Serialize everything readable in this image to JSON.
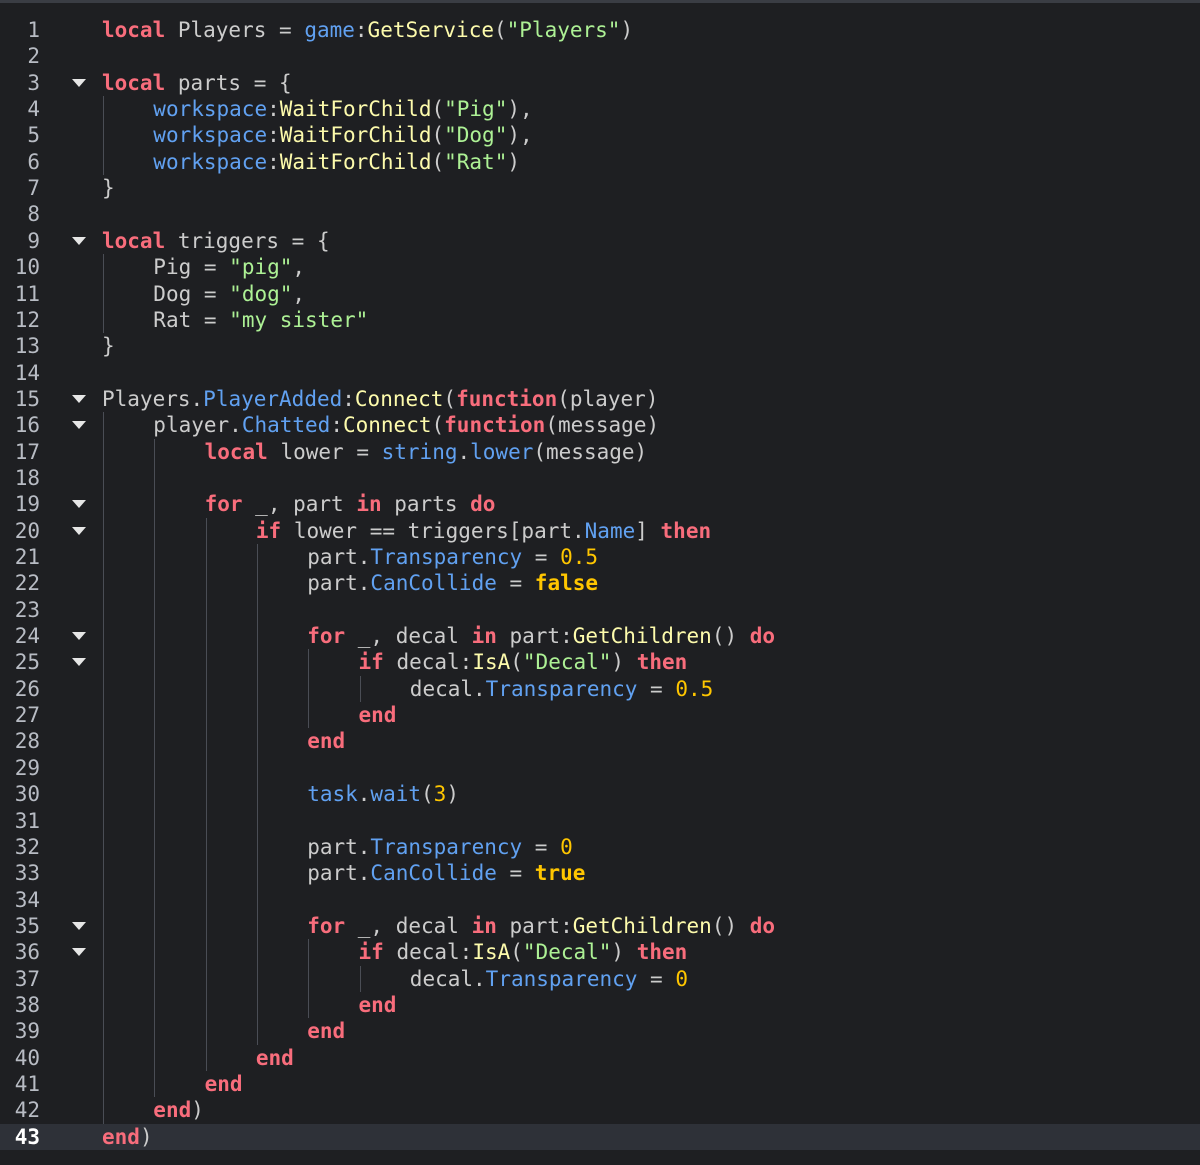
{
  "editor": {
    "language": "Luau",
    "current_line": 43,
    "theme": {
      "background": "#1e1f22",
      "keyword": "#f86d7c",
      "string": "#adf195",
      "number": "#ffc600",
      "function": "#fdfbac",
      "property": "#61a1f1",
      "text": "#cccccc",
      "current_line": "#2e3138"
    },
    "lines": [
      {
        "n": "1",
        "fold": false,
        "depth": 0,
        "tokens": [
          [
            "kw",
            "local"
          ],
          [
            "id",
            " Players "
          ],
          [
            "op",
            "= "
          ],
          [
            "prop",
            "game"
          ],
          [
            "op",
            ":"
          ],
          [
            "fn",
            "GetService"
          ],
          [
            "op",
            "("
          ],
          [
            "str",
            "\"Players\""
          ],
          [
            "op",
            ")"
          ]
        ]
      },
      {
        "n": "2",
        "fold": false,
        "depth": 0,
        "tokens": []
      },
      {
        "n": "3",
        "fold": true,
        "depth": 0,
        "tokens": [
          [
            "kw",
            "local"
          ],
          [
            "id",
            " parts "
          ],
          [
            "op",
            "= {"
          ]
        ]
      },
      {
        "n": "4",
        "fold": false,
        "depth": 1,
        "tokens": [
          [
            "prop",
            "workspace"
          ],
          [
            "op",
            ":"
          ],
          [
            "fn",
            "WaitForChild"
          ],
          [
            "op",
            "("
          ],
          [
            "str",
            "\"Pig\""
          ],
          [
            "op",
            "),"
          ]
        ]
      },
      {
        "n": "5",
        "fold": false,
        "depth": 1,
        "tokens": [
          [
            "prop",
            "workspace"
          ],
          [
            "op",
            ":"
          ],
          [
            "fn",
            "WaitForChild"
          ],
          [
            "op",
            "("
          ],
          [
            "str",
            "\"Dog\""
          ],
          [
            "op",
            "),"
          ]
        ]
      },
      {
        "n": "6",
        "fold": false,
        "depth": 1,
        "tokens": [
          [
            "prop",
            "workspace"
          ],
          [
            "op",
            ":"
          ],
          [
            "fn",
            "WaitForChild"
          ],
          [
            "op",
            "("
          ],
          [
            "str",
            "\"Rat\""
          ],
          [
            "op",
            ")"
          ]
        ]
      },
      {
        "n": "7",
        "fold": false,
        "depth": 0,
        "tokens": [
          [
            "op",
            "}"
          ]
        ]
      },
      {
        "n": "8",
        "fold": false,
        "depth": 0,
        "tokens": []
      },
      {
        "n": "9",
        "fold": true,
        "depth": 0,
        "tokens": [
          [
            "kw",
            "local"
          ],
          [
            "id",
            " triggers "
          ],
          [
            "op",
            "= {"
          ]
        ]
      },
      {
        "n": "10",
        "fold": false,
        "depth": 1,
        "tokens": [
          [
            "id",
            "Pig "
          ],
          [
            "op",
            "= "
          ],
          [
            "str",
            "\"pig\""
          ],
          [
            "op",
            ","
          ]
        ]
      },
      {
        "n": "11",
        "fold": false,
        "depth": 1,
        "tokens": [
          [
            "id",
            "Dog "
          ],
          [
            "op",
            "= "
          ],
          [
            "str",
            "\"dog\""
          ],
          [
            "op",
            ","
          ]
        ]
      },
      {
        "n": "12",
        "fold": false,
        "depth": 1,
        "tokens": [
          [
            "id",
            "Rat "
          ],
          [
            "op",
            "= "
          ],
          [
            "str",
            "\"my sister\""
          ]
        ]
      },
      {
        "n": "13",
        "fold": false,
        "depth": 0,
        "tokens": [
          [
            "op",
            "}"
          ]
        ]
      },
      {
        "n": "14",
        "fold": false,
        "depth": 0,
        "tokens": []
      },
      {
        "n": "15",
        "fold": true,
        "depth": 0,
        "tokens": [
          [
            "id",
            "Players"
          ],
          [
            "op",
            "."
          ],
          [
            "prop",
            "PlayerAdded"
          ],
          [
            "op",
            ":"
          ],
          [
            "fn",
            "Connect"
          ],
          [
            "op",
            "("
          ],
          [
            "kw",
            "function"
          ],
          [
            "op",
            "("
          ],
          [
            "id",
            "player"
          ],
          [
            "op",
            ")"
          ]
        ]
      },
      {
        "n": "16",
        "fold": true,
        "depth": 1,
        "tokens": [
          [
            "id",
            "player"
          ],
          [
            "op",
            "."
          ],
          [
            "prop",
            "Chatted"
          ],
          [
            "op",
            ":"
          ],
          [
            "fn",
            "Connect"
          ],
          [
            "op",
            "("
          ],
          [
            "kw",
            "function"
          ],
          [
            "op",
            "("
          ],
          [
            "id",
            "message"
          ],
          [
            "op",
            ")"
          ]
        ]
      },
      {
        "n": "17",
        "fold": false,
        "depth": 2,
        "tokens": [
          [
            "kw",
            "local"
          ],
          [
            "id",
            " lower "
          ],
          [
            "op",
            "= "
          ],
          [
            "prop",
            "string"
          ],
          [
            "op",
            "."
          ],
          [
            "prop",
            "lower"
          ],
          [
            "op",
            "("
          ],
          [
            "id",
            "message"
          ],
          [
            "op",
            ")"
          ]
        ]
      },
      {
        "n": "18",
        "fold": false,
        "depth": 2,
        "tokens": []
      },
      {
        "n": "19",
        "fold": true,
        "depth": 2,
        "tokens": [
          [
            "kw",
            "for"
          ],
          [
            "id",
            " _, part "
          ],
          [
            "kw",
            "in"
          ],
          [
            "id",
            " parts "
          ],
          [
            "kw",
            "do"
          ]
        ]
      },
      {
        "n": "20",
        "fold": true,
        "depth": 3,
        "tokens": [
          [
            "kw",
            "if"
          ],
          [
            "id",
            " lower "
          ],
          [
            "op",
            "== "
          ],
          [
            "id",
            "triggers[part."
          ],
          [
            "prop",
            "Name"
          ],
          [
            "id",
            "] "
          ],
          [
            "kw",
            "then"
          ]
        ]
      },
      {
        "n": "21",
        "fold": false,
        "depth": 4,
        "tokens": [
          [
            "id",
            "part"
          ],
          [
            "op",
            "."
          ],
          [
            "prop",
            "Transparency"
          ],
          [
            "op",
            " = "
          ],
          [
            "num",
            "0.5"
          ]
        ]
      },
      {
        "n": "22",
        "fold": false,
        "depth": 4,
        "tokens": [
          [
            "id",
            "part"
          ],
          [
            "op",
            "."
          ],
          [
            "prop",
            "CanCollide"
          ],
          [
            "op",
            " = "
          ],
          [
            "bool",
            "false"
          ]
        ]
      },
      {
        "n": "23",
        "fold": false,
        "depth": 4,
        "tokens": []
      },
      {
        "n": "24",
        "fold": true,
        "depth": 4,
        "tokens": [
          [
            "kw",
            "for"
          ],
          [
            "id",
            " _, decal "
          ],
          [
            "kw",
            "in"
          ],
          [
            "id",
            " part"
          ],
          [
            "op",
            ":"
          ],
          [
            "fn",
            "GetChildren"
          ],
          [
            "op",
            "() "
          ],
          [
            "kw",
            "do"
          ]
        ]
      },
      {
        "n": "25",
        "fold": true,
        "depth": 5,
        "tokens": [
          [
            "kw",
            "if"
          ],
          [
            "id",
            " decal"
          ],
          [
            "op",
            ":"
          ],
          [
            "fn",
            "IsA"
          ],
          [
            "op",
            "("
          ],
          [
            "str",
            "\"Decal\""
          ],
          [
            "op",
            ") "
          ],
          [
            "kw",
            "then"
          ]
        ]
      },
      {
        "n": "26",
        "fold": false,
        "depth": 6,
        "tokens": [
          [
            "id",
            "decal"
          ],
          [
            "op",
            "."
          ],
          [
            "prop",
            "Transparency"
          ],
          [
            "op",
            " = "
          ],
          [
            "num",
            "0.5"
          ]
        ]
      },
      {
        "n": "27",
        "fold": false,
        "depth": 5,
        "tokens": [
          [
            "kw",
            "end"
          ]
        ]
      },
      {
        "n": "28",
        "fold": false,
        "depth": 4,
        "tokens": [
          [
            "kw",
            "end"
          ]
        ]
      },
      {
        "n": "29",
        "fold": false,
        "depth": 4,
        "tokens": []
      },
      {
        "n": "30",
        "fold": false,
        "depth": 4,
        "tokens": [
          [
            "prop",
            "task"
          ],
          [
            "op",
            "."
          ],
          [
            "prop",
            "wait"
          ],
          [
            "op",
            "("
          ],
          [
            "num",
            "3"
          ],
          [
            "op",
            ")"
          ]
        ]
      },
      {
        "n": "31",
        "fold": false,
        "depth": 4,
        "tokens": []
      },
      {
        "n": "32",
        "fold": false,
        "depth": 4,
        "tokens": [
          [
            "id",
            "part"
          ],
          [
            "op",
            "."
          ],
          [
            "prop",
            "Transparency"
          ],
          [
            "op",
            " = "
          ],
          [
            "num",
            "0"
          ]
        ]
      },
      {
        "n": "33",
        "fold": false,
        "depth": 4,
        "tokens": [
          [
            "id",
            "part"
          ],
          [
            "op",
            "."
          ],
          [
            "prop",
            "CanCollide"
          ],
          [
            "op",
            " = "
          ],
          [
            "bool",
            "true"
          ]
        ]
      },
      {
        "n": "34",
        "fold": false,
        "depth": 4,
        "tokens": []
      },
      {
        "n": "35",
        "fold": true,
        "depth": 4,
        "tokens": [
          [
            "kw",
            "for"
          ],
          [
            "id",
            " _, decal "
          ],
          [
            "kw",
            "in"
          ],
          [
            "id",
            " part"
          ],
          [
            "op",
            ":"
          ],
          [
            "fn",
            "GetChildren"
          ],
          [
            "op",
            "() "
          ],
          [
            "kw",
            "do"
          ]
        ]
      },
      {
        "n": "36",
        "fold": true,
        "depth": 5,
        "tokens": [
          [
            "kw",
            "if"
          ],
          [
            "id",
            " decal"
          ],
          [
            "op",
            ":"
          ],
          [
            "fn",
            "IsA"
          ],
          [
            "op",
            "("
          ],
          [
            "str",
            "\"Decal\""
          ],
          [
            "op",
            ") "
          ],
          [
            "kw",
            "then"
          ]
        ]
      },
      {
        "n": "37",
        "fold": false,
        "depth": 6,
        "tokens": [
          [
            "id",
            "decal"
          ],
          [
            "op",
            "."
          ],
          [
            "prop",
            "Transparency"
          ],
          [
            "op",
            " = "
          ],
          [
            "num",
            "0"
          ]
        ]
      },
      {
        "n": "38",
        "fold": false,
        "depth": 5,
        "tokens": [
          [
            "kw",
            "end"
          ]
        ]
      },
      {
        "n": "39",
        "fold": false,
        "depth": 4,
        "tokens": [
          [
            "kw",
            "end"
          ]
        ]
      },
      {
        "n": "40",
        "fold": false,
        "depth": 3,
        "tokens": [
          [
            "kw",
            "end"
          ]
        ]
      },
      {
        "n": "41",
        "fold": false,
        "depth": 2,
        "tokens": [
          [
            "kw",
            "end"
          ]
        ]
      },
      {
        "n": "42",
        "fold": false,
        "depth": 1,
        "tokens": [
          [
            "kw",
            "end"
          ],
          [
            "op",
            ")"
          ]
        ]
      },
      {
        "n": "43",
        "fold": false,
        "depth": 0,
        "tokens": [
          [
            "kw",
            "end"
          ],
          [
            "op",
            ")"
          ]
        ]
      }
    ]
  }
}
